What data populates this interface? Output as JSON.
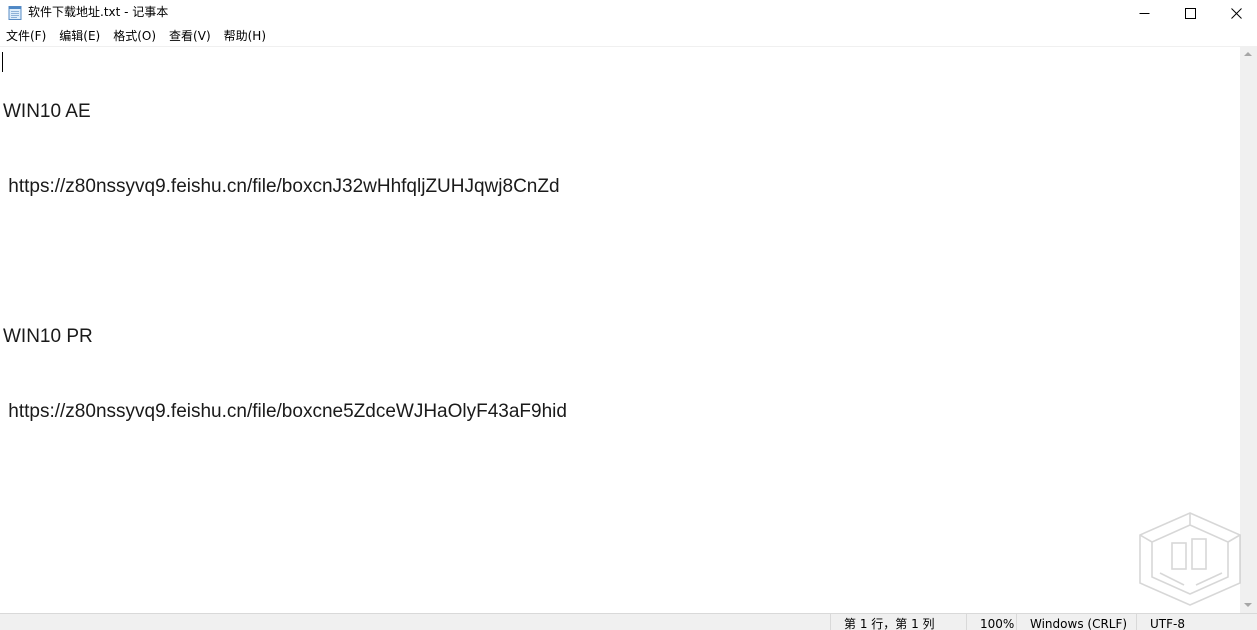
{
  "window": {
    "title": "软件下载地址.txt - 记事本",
    "icon": "notepad-icon",
    "controls": {
      "minimize_icon": "minimize-icon",
      "maximize_icon": "maximize-icon",
      "close_icon": "close-icon"
    }
  },
  "menu": {
    "items": [
      {
        "label": "文件(F)"
      },
      {
        "label": "编辑(E)"
      },
      {
        "label": "格式(O)"
      },
      {
        "label": "查看(V)"
      },
      {
        "label": "帮助(H)"
      }
    ]
  },
  "document": {
    "lines": [
      "WIN10 AE",
      " https://z80nssyvq9.feishu.cn/file/boxcnJ32wHhfqljZUHJqwj8CnZd",
      "",
      "WIN10 PR",
      " https://z80nssyvq9.feishu.cn/file/boxcne5ZdceWJHaOlyF43aF9hid"
    ]
  },
  "status": {
    "position": "第 1 行，第 1 列",
    "zoom": "100%",
    "line_ending": "Windows (CRLF)",
    "encoding": "UTF-8"
  },
  "colors": {
    "statusbar_bg": "#f0f0f0",
    "text": "#1a1a1a"
  }
}
